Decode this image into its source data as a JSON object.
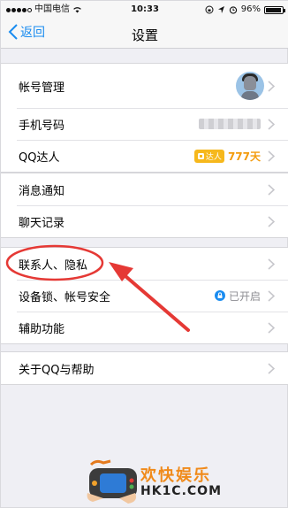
{
  "status_bar": {
    "carrier": "中国电信",
    "time": "10:33",
    "battery_percent_text": "96%",
    "battery_level": 0.96
  },
  "nav": {
    "back_label": "返回",
    "title": "设置"
  },
  "groups": {
    "account": {
      "account_manage": "帐号管理",
      "phone_number": "手机号码",
      "qq_daren": "QQ达人",
      "daren_badge": "达人",
      "daren_days": "777天"
    },
    "messages": {
      "notify": "消息通知",
      "chat_records": "聊天记录"
    },
    "privacy": {
      "contacts_privacy": "联系人、隐私",
      "device_lock": "设备锁、帐号安全",
      "device_lock_status": "已开启",
      "accessibility": "辅助功能"
    },
    "about": {
      "about_help": "关于QQ与帮助"
    }
  },
  "watermark": {
    "cn": "欢快娱乐",
    "en": "HK1C.COM"
  },
  "colors": {
    "accent": "#1a8cf0",
    "annotation": "#e53935",
    "daren": "#f6b81c"
  }
}
